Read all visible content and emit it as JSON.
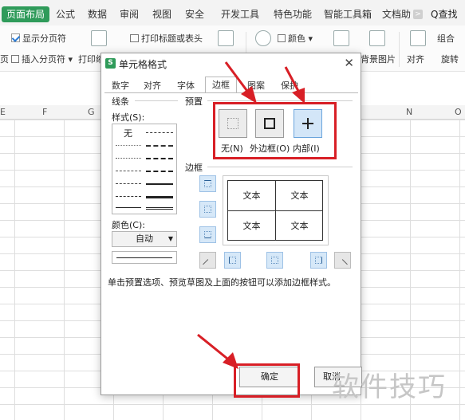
{
  "ribbon": {
    "tabs": [
      "页面布局",
      "公式",
      "数据",
      "审阅",
      "视图",
      "安全",
      "开发工具",
      "特色功能",
      "智能工具箱",
      "文档助"
    ],
    "more": ">",
    "search_label": "Q查找",
    "toolbar": {
      "show_page_break": "显示分页符",
      "print_title": "打印标题或表头",
      "color": "颜色",
      "combine": "组合",
      "insert_page_break": "插入分页符",
      "print_scale": "打印缩",
      "background_image": "背景图片",
      "align": "对齐",
      "rotate": "旋转",
      "left_edge": "页"
    }
  },
  "grid": {
    "columns": [
      "E",
      "F",
      "G",
      "N",
      "O"
    ]
  },
  "dialog": {
    "title": "单元格格式",
    "close": "✕",
    "tabs": [
      "数字",
      "对齐",
      "字体",
      "边框",
      "图案",
      "保护"
    ],
    "active_tab": "边框",
    "line_section": "线条",
    "style_label": "样式(S):",
    "style_none": "无",
    "color_label": "颜色(C):",
    "color_value": "自动",
    "preset_section": "预置",
    "presets": [
      "无(N)",
      "外边框(O)",
      "内部(I)"
    ],
    "border_section": "边框",
    "preview_text": [
      "文本",
      "文本",
      "文本",
      "文本"
    ],
    "hint": "单击预置选项、预览草图及上面的按钮可以添加边框样式。",
    "ok": "确定",
    "cancel": "取消"
  },
  "annotation_color": "#d81f26",
  "watermark": "软件技巧"
}
